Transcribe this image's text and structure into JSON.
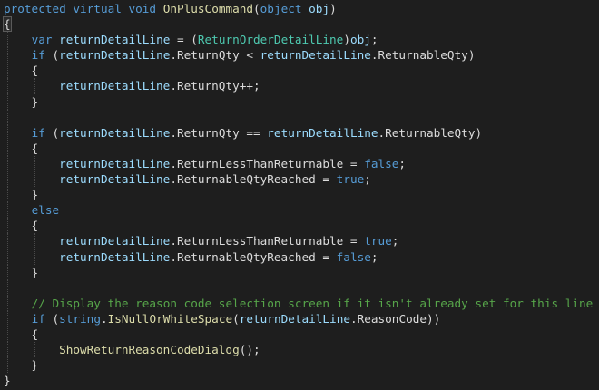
{
  "editor": {
    "background": "#1e1e1e",
    "colors": {
      "keyword": "#569cd6",
      "method": "#dcdcaa",
      "type": "#4ec9b0",
      "variable": "#9cdcfe",
      "punctuation": "#dcdcdc",
      "comment": "#57a64a"
    },
    "lines": [
      [
        {
          "text": "protected",
          "cls": "k"
        },
        {
          "text": " ",
          "cls": "p"
        },
        {
          "text": "virtual",
          "cls": "k"
        },
        {
          "text": " ",
          "cls": "p"
        },
        {
          "text": "void",
          "cls": "k"
        },
        {
          "text": " ",
          "cls": "p"
        },
        {
          "text": "OnPlusCommand",
          "cls": "m"
        },
        {
          "text": "(",
          "cls": "p"
        },
        {
          "text": "object",
          "cls": "k"
        },
        {
          "text": " ",
          "cls": "p"
        },
        {
          "text": "obj",
          "cls": "v"
        },
        {
          "text": ")",
          "cls": "p"
        }
      ],
      [
        {
          "text": "{",
          "cls": "p",
          "hl": true
        }
      ],
      [
        {
          "text": "    ",
          "cls": "p"
        },
        {
          "text": "var",
          "cls": "k"
        },
        {
          "text": " ",
          "cls": "p"
        },
        {
          "text": "returnDetailLine",
          "cls": "v"
        },
        {
          "text": " = (",
          "cls": "p"
        },
        {
          "text": "ReturnOrderDetailLine",
          "cls": "t"
        },
        {
          "text": ")",
          "cls": "p"
        },
        {
          "text": "obj",
          "cls": "v"
        },
        {
          "text": ";",
          "cls": "p"
        }
      ],
      [
        {
          "text": "    ",
          "cls": "p"
        },
        {
          "text": "if",
          "cls": "k"
        },
        {
          "text": " (",
          "cls": "p"
        },
        {
          "text": "returnDetailLine",
          "cls": "v"
        },
        {
          "text": ".",
          "cls": "p"
        },
        {
          "text": "ReturnQty",
          "cls": "p"
        },
        {
          "text": " < ",
          "cls": "p"
        },
        {
          "text": "returnDetailLine",
          "cls": "v"
        },
        {
          "text": ".",
          "cls": "p"
        },
        {
          "text": "ReturnableQty",
          "cls": "p"
        },
        {
          "text": ")",
          "cls": "p"
        }
      ],
      [
        {
          "text": "    {",
          "cls": "p"
        }
      ],
      [
        {
          "text": "        ",
          "cls": "p"
        },
        {
          "text": "returnDetailLine",
          "cls": "v"
        },
        {
          "text": ".",
          "cls": "p"
        },
        {
          "text": "ReturnQty",
          "cls": "p"
        },
        {
          "text": "++;",
          "cls": "p"
        }
      ],
      [
        {
          "text": "    }",
          "cls": "p"
        }
      ],
      [
        {
          "text": "",
          "cls": "p"
        }
      ],
      [
        {
          "text": "    ",
          "cls": "p"
        },
        {
          "text": "if",
          "cls": "k"
        },
        {
          "text": " (",
          "cls": "p"
        },
        {
          "text": "returnDetailLine",
          "cls": "v"
        },
        {
          "text": ".",
          "cls": "p"
        },
        {
          "text": "ReturnQty",
          "cls": "p"
        },
        {
          "text": " == ",
          "cls": "p"
        },
        {
          "text": "returnDetailLine",
          "cls": "v"
        },
        {
          "text": ".",
          "cls": "p"
        },
        {
          "text": "ReturnableQty",
          "cls": "p"
        },
        {
          "text": ")",
          "cls": "p"
        }
      ],
      [
        {
          "text": "    {",
          "cls": "p"
        }
      ],
      [
        {
          "text": "        ",
          "cls": "p"
        },
        {
          "text": "returnDetailLine",
          "cls": "v"
        },
        {
          "text": ".",
          "cls": "p"
        },
        {
          "text": "ReturnLessThanReturnable",
          "cls": "p"
        },
        {
          "text": " = ",
          "cls": "p"
        },
        {
          "text": "false",
          "cls": "k"
        },
        {
          "text": ";",
          "cls": "p"
        }
      ],
      [
        {
          "text": "        ",
          "cls": "p"
        },
        {
          "text": "returnDetailLine",
          "cls": "v"
        },
        {
          "text": ".",
          "cls": "p"
        },
        {
          "text": "ReturnableQtyReached",
          "cls": "p"
        },
        {
          "text": " = ",
          "cls": "p"
        },
        {
          "text": "true",
          "cls": "k"
        },
        {
          "text": ";",
          "cls": "p"
        }
      ],
      [
        {
          "text": "    }",
          "cls": "p"
        }
      ],
      [
        {
          "text": "    ",
          "cls": "p"
        },
        {
          "text": "else",
          "cls": "k"
        }
      ],
      [
        {
          "text": "    {",
          "cls": "p"
        }
      ],
      [
        {
          "text": "        ",
          "cls": "p"
        },
        {
          "text": "returnDetailLine",
          "cls": "v"
        },
        {
          "text": ".",
          "cls": "p"
        },
        {
          "text": "ReturnLessThanReturnable",
          "cls": "p"
        },
        {
          "text": " = ",
          "cls": "p"
        },
        {
          "text": "true",
          "cls": "k"
        },
        {
          "text": ";",
          "cls": "p"
        }
      ],
      [
        {
          "text": "        ",
          "cls": "p"
        },
        {
          "text": "returnDetailLine",
          "cls": "v"
        },
        {
          "text": ".",
          "cls": "p"
        },
        {
          "text": "ReturnableQtyReached",
          "cls": "p"
        },
        {
          "text": " = ",
          "cls": "p"
        },
        {
          "text": "false",
          "cls": "k"
        },
        {
          "text": ";",
          "cls": "p"
        }
      ],
      [
        {
          "text": "    }",
          "cls": "p"
        }
      ],
      [
        {
          "text": "",
          "cls": "p"
        }
      ],
      [
        {
          "text": "    ",
          "cls": "p"
        },
        {
          "text": "// Display the reason code selection screen if it isn't already set for this line",
          "cls": "c"
        }
      ],
      [
        {
          "text": "    ",
          "cls": "p"
        },
        {
          "text": "if",
          "cls": "k"
        },
        {
          "text": " (",
          "cls": "p"
        },
        {
          "text": "string",
          "cls": "k"
        },
        {
          "text": ".",
          "cls": "p"
        },
        {
          "text": "IsNullOrWhiteSpace",
          "cls": "m"
        },
        {
          "text": "(",
          "cls": "p"
        },
        {
          "text": "returnDetailLine",
          "cls": "v"
        },
        {
          "text": ".",
          "cls": "p"
        },
        {
          "text": "ReasonCode",
          "cls": "p"
        },
        {
          "text": "))",
          "cls": "p"
        }
      ],
      [
        {
          "text": "    {",
          "cls": "p"
        }
      ],
      [
        {
          "text": "        ",
          "cls": "p"
        },
        {
          "text": "ShowReturnReasonCodeDialog",
          "cls": "m"
        },
        {
          "text": "();",
          "cls": "p"
        }
      ],
      [
        {
          "text": "    }",
          "cls": "p"
        }
      ],
      [
        {
          "text": "}",
          "cls": "p"
        }
      ]
    ]
  }
}
